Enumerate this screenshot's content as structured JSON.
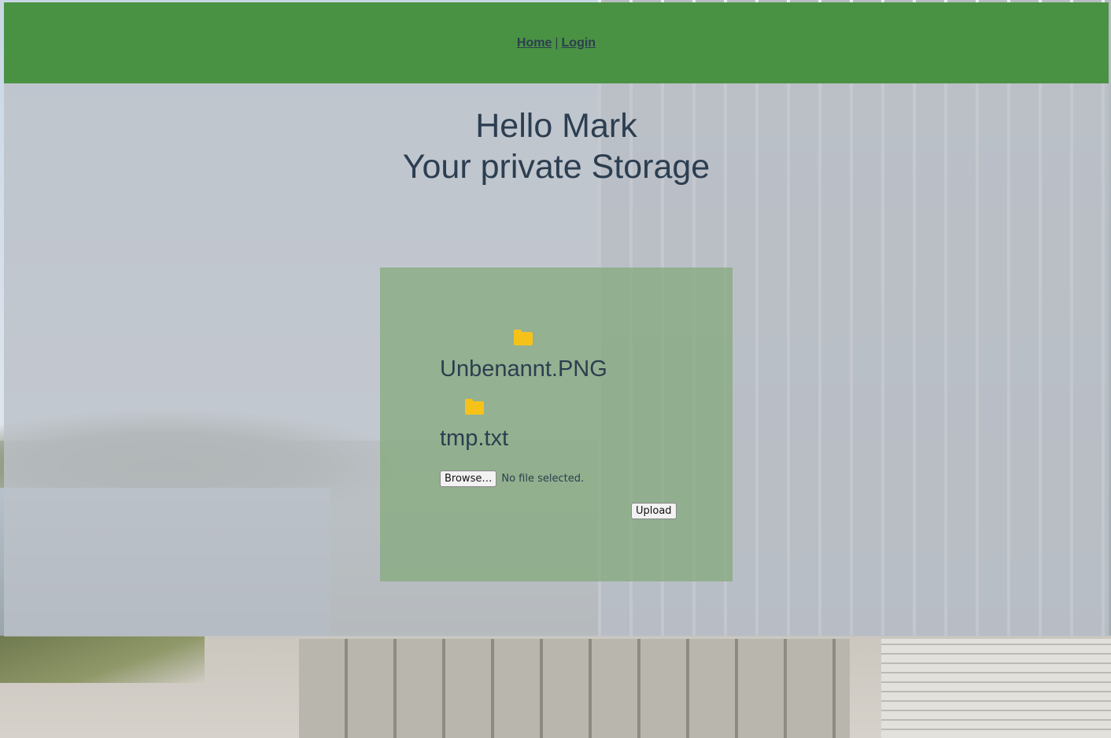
{
  "nav": {
    "home_label": "Home",
    "separator": "|",
    "login_label": "Login"
  },
  "page": {
    "greeting": "Hello Mark",
    "subtitle": "Your private Storage"
  },
  "files": [
    {
      "name": "Unbenannt.PNG",
      "icon": "folder-icon"
    },
    {
      "name": "tmp.txt",
      "icon": "folder-icon"
    }
  ],
  "upload": {
    "browse_label": "Browse…",
    "file_status": "No file selected.",
    "upload_label": "Upload"
  },
  "colors": {
    "navbar": "#4a9243",
    "text": "#2c3e50",
    "folder": "#f6c21a",
    "storage_box": "#84aa7c"
  }
}
